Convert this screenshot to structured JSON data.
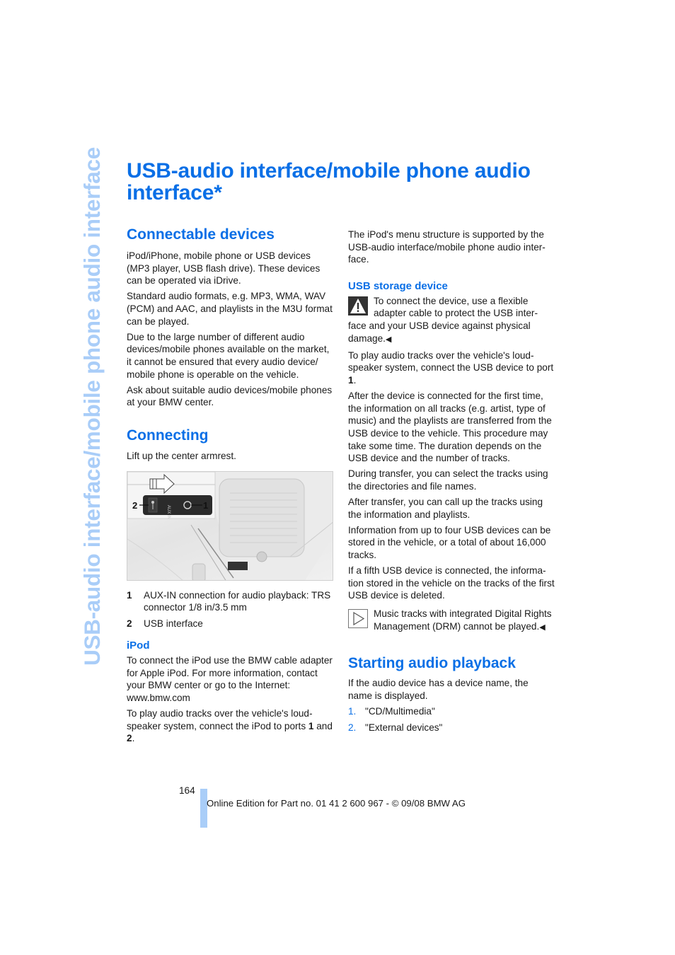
{
  "side_title": "USB-audio interface/mobile phone audio interface",
  "title": "USB-audio interface/mobile phone audio interface*",
  "left": {
    "connectable": {
      "heading": "Connectable devices",
      "paragraphs": [
        "iPod/iPhone, mobile phone or USB devices (MP3 player, USB flash drive). These devices can be operated via iDrive.",
        "Standard audio formats, e.g. MP3, WMA, WAV (PCM) and AAC, and playlists in the M3U format can be played.",
        "Due to the large number of different audio devices/mobile phones available on the market, it cannot be ensured that every audio device/ mobile phone is operable on the vehicle.",
        "Ask about suitable audio devices/mobile phones at your BMW center."
      ]
    },
    "connecting": {
      "heading": "Connecting",
      "intro": "Lift up the center armrest.",
      "figure": {
        "callout_1": "1",
        "callout_2": "2",
        "port_label": "AUX IN"
      },
      "legend": [
        {
          "num": "1",
          "text": "AUX-IN connection for audio playback: TRS connector 1/8 in/3.5 mm"
        },
        {
          "num": "2",
          "text": "USB interface"
        }
      ]
    },
    "ipod": {
      "heading": "iPod",
      "p1": "To connect the iPod use the BMW cable adapter for Apple iPod. For more information, contact your BMW center or go to the Internet: www.bmw.com",
      "p2_pre": "To play audio tracks over the vehicle's loud-speaker system, connect the iPod to ports ",
      "p2_b1": "1",
      "p2_mid": " and ",
      "p2_b2": "2",
      "p2_post": "."
    }
  },
  "right": {
    "ipod_menu": "The iPod's menu structure is supported by the USB-audio interface/mobile phone audio inter-face.",
    "usb": {
      "heading": "USB storage device",
      "warning": "To connect the device, use a flexible adapter cable to protect the USB inter-face and your USB device against physical damage.",
      "p_port_pre": "To play audio tracks over the vehicle's loud-speaker system, connect the USB device to port ",
      "p_port_b": "1",
      "p_port_post": ".",
      "paragraphs": [
        "After the device is connected for the first time, the information on all tracks (e.g. artist, type of music) and the playlists are transferred from the USB device to the vehicle. This procedure may take some time. The duration depends on the USB device and the number of tracks.",
        "During transfer, you can select the tracks using the directories and file names.",
        "After transfer, you can call up the tracks using the information and playlists.",
        "Information from up to four USB devices can be stored in the vehicle, or a total of about 16,000 tracks.",
        "If a fifth USB device is connected, the informa-tion stored in the vehicle on the tracks of the first USB device is deleted."
      ],
      "note": "Music tracks with integrated Digital Rights Management (DRM) cannot be played."
    },
    "playback": {
      "heading": "Starting audio playback",
      "intro": "If the audio device has a device name, the name is displayed.",
      "steps": [
        {
          "num": "1.",
          "text": "\"CD/Multimedia\""
        },
        {
          "num": "2.",
          "text": "\"External devices\""
        }
      ]
    }
  },
  "end_mark": "◀",
  "footer": {
    "page_number": "164",
    "text": "Online Edition for Part no. 01 41 2 600 967  - © 09/08 BMW AG"
  }
}
